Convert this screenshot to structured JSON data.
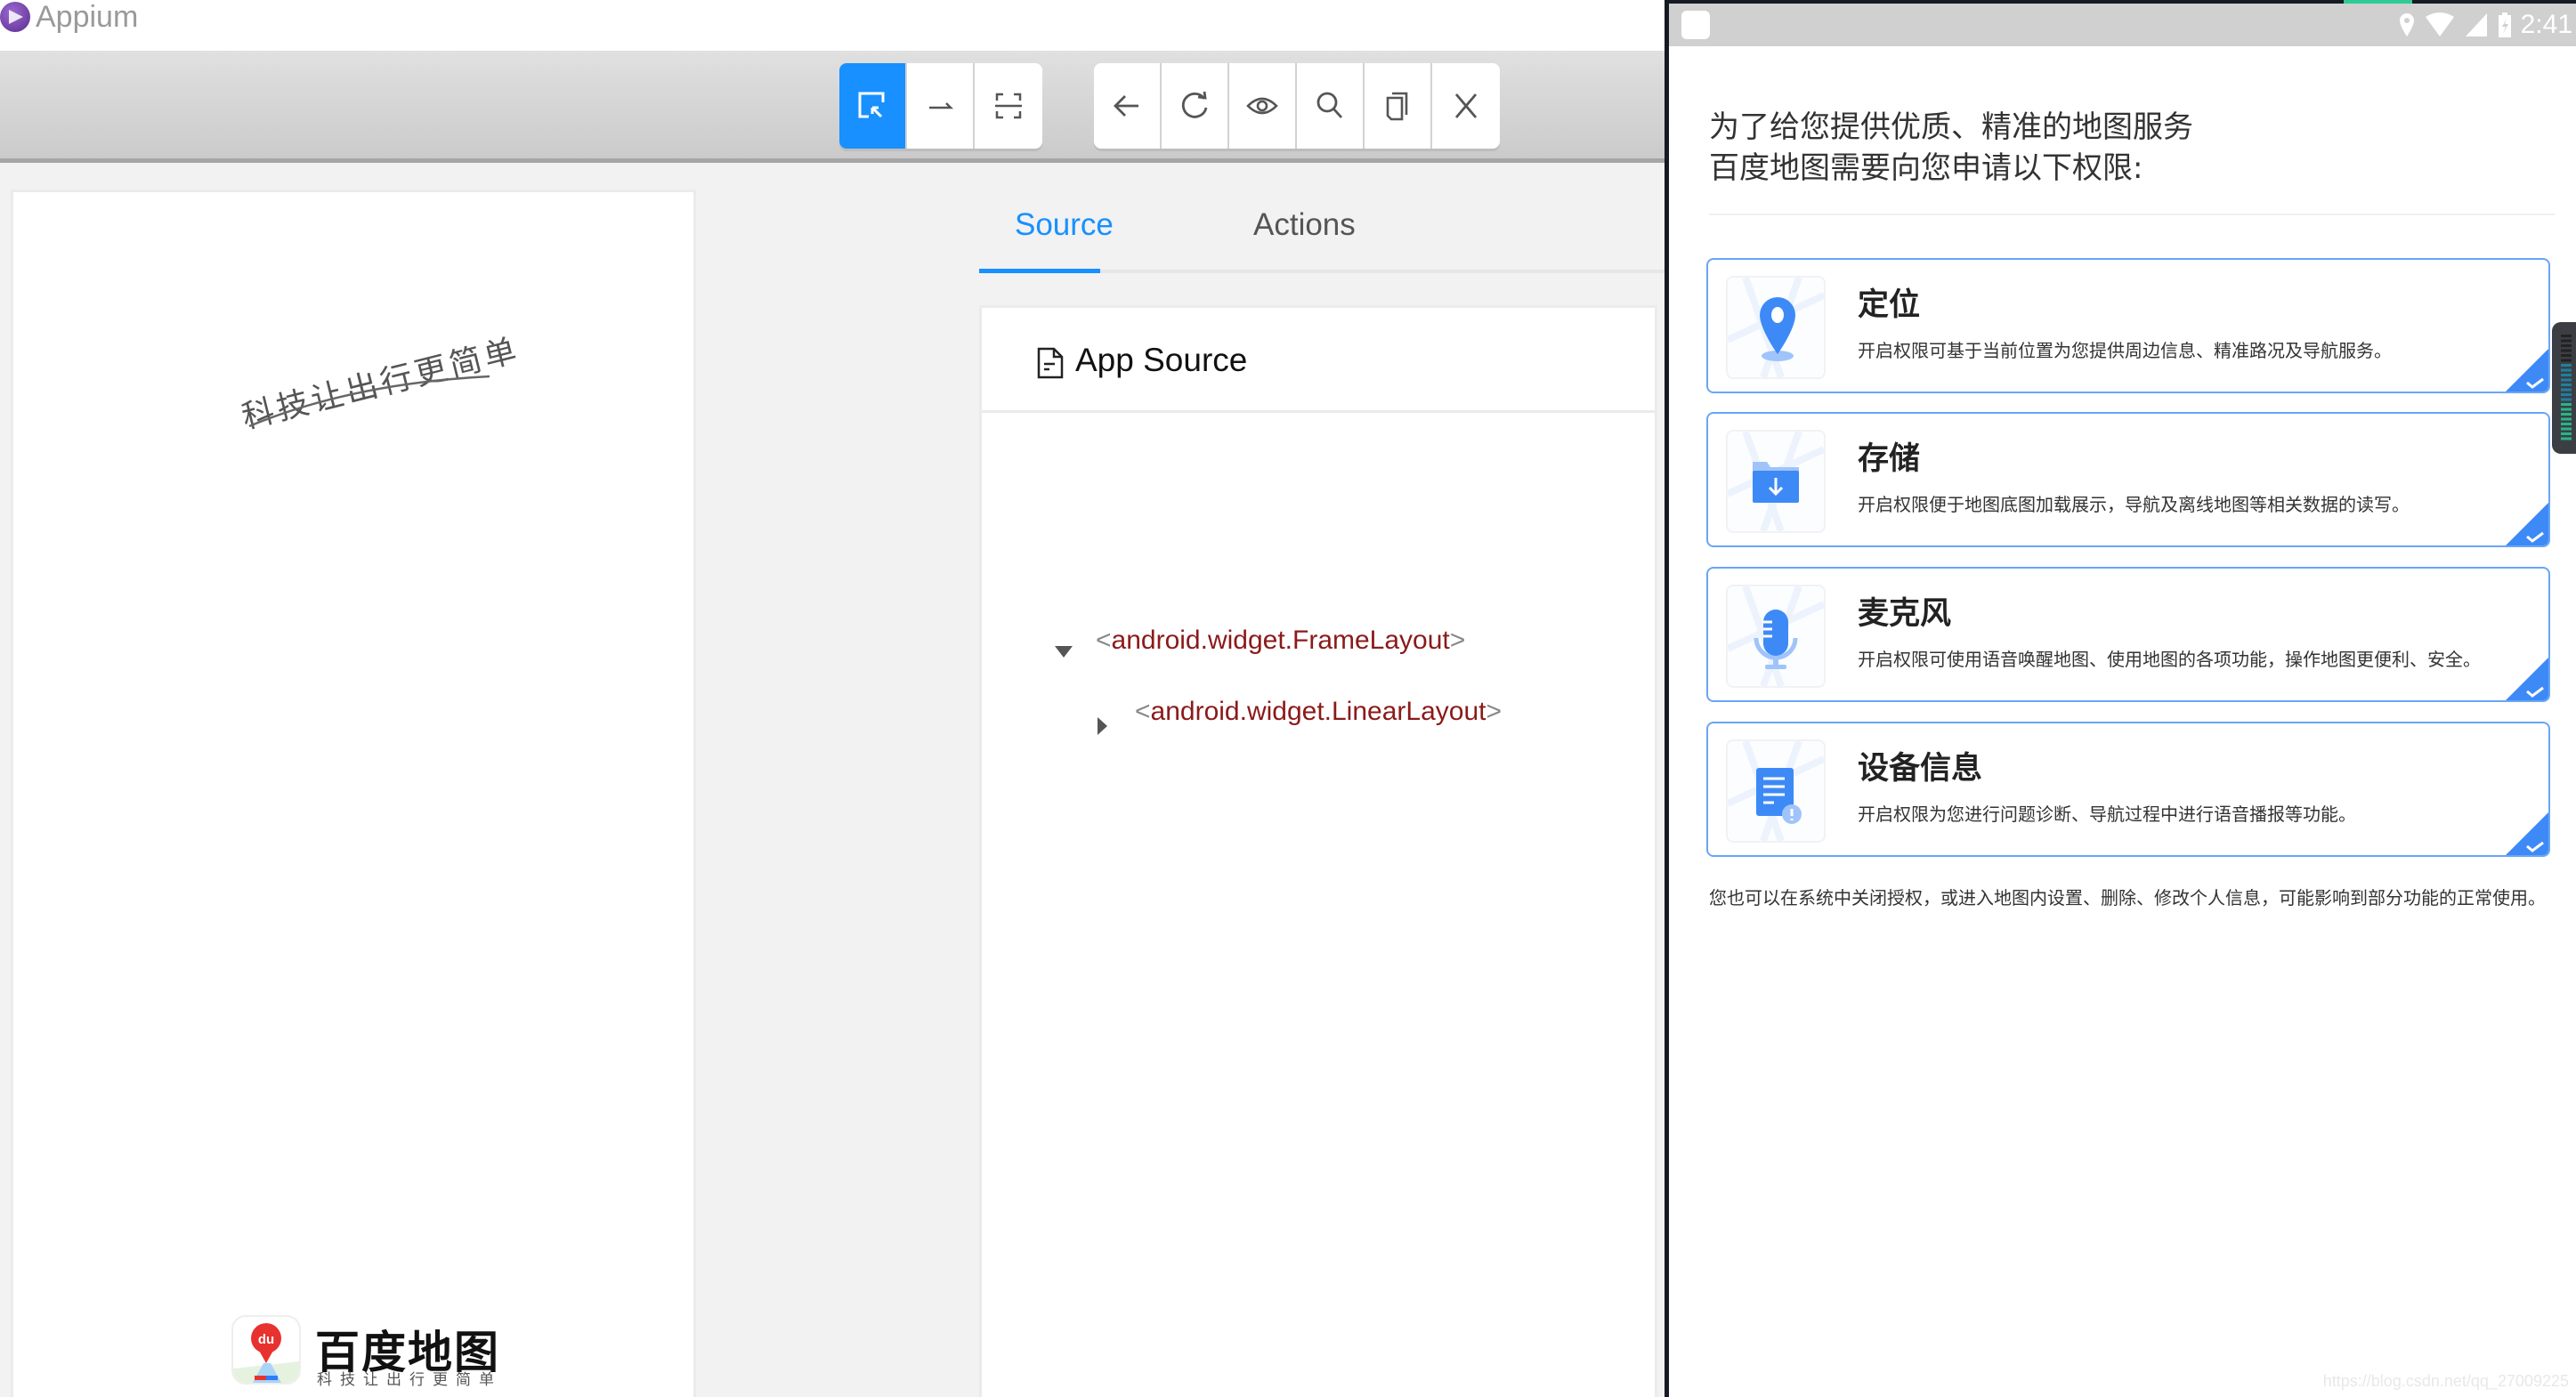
{
  "app": {
    "title": "Appium"
  },
  "toolbar": {
    "group1": [
      {
        "name": "select-elements",
        "icon": "select-element-icon",
        "active": true
      },
      {
        "name": "swipe-by-coordinates",
        "icon": "swipe-icon",
        "active": false
      },
      {
        "name": "tap-by-coordinates",
        "icon": "scan-frame-icon",
        "active": false
      }
    ],
    "group2": [
      {
        "name": "back",
        "icon": "arrow-left-icon"
      },
      {
        "name": "refresh",
        "icon": "refresh-icon"
      },
      {
        "name": "start-recording",
        "icon": "eye-icon"
      },
      {
        "name": "search-elements",
        "icon": "search-icon"
      },
      {
        "name": "copy-xml-source",
        "icon": "copy-icon"
      },
      {
        "name": "quit-session",
        "icon": "close-icon"
      }
    ]
  },
  "screenshot": {
    "slogan": "科技让出行更简单",
    "logo_name": "百度地图",
    "logo_tagline": "科技让出行更简单",
    "logo_badge": "du"
  },
  "tabs": [
    {
      "label": "Source",
      "active": true
    },
    {
      "label": "Actions",
      "active": false
    }
  ],
  "source": {
    "title": "App Source",
    "tree": [
      {
        "tag": "android.widget.FrameLayout",
        "expanded": true,
        "depth": 0
      },
      {
        "tag": "android.widget.LinearLayout",
        "expanded": false,
        "depth": 1
      }
    ]
  },
  "device": {
    "status_bar": {
      "time": "2:41",
      "icons": [
        "location-icon",
        "wifi-icon",
        "signal-icon",
        "battery-charging-icon"
      ]
    },
    "intro_line1": "为了给您提供优质、精准的地图服务",
    "intro_line2": "百度地图需要向您申请以下权限:",
    "permissions": [
      {
        "title": "定位",
        "desc": "开启权限可基于当前位置为您提供周边信息、精准路况及导航服务。",
        "icon": "location-pin-icon",
        "checked": true
      },
      {
        "title": "存储",
        "desc": "开启权限便于地图底图加载展示，导航及离线地图等相关数据的读写。",
        "icon": "folder-download-icon",
        "checked": true
      },
      {
        "title": "麦克风",
        "desc": "开启权限可使用语音唤醒地图、使用地图的各项功能，操作地图更便利、安全。",
        "icon": "microphone-icon",
        "checked": true
      },
      {
        "title": "设备信息",
        "desc": "开启权限为您进行问题诊断、导航过程中进行语音播报等功能。",
        "icon": "device-info-icon",
        "checked": true
      }
    ],
    "footer_note": "您也可以在系统中关闭授权，或进入地图内设置、删除、修改个人信息，可能影响到部分功能的正常使用。",
    "watermark": "https://blog.csdn.net/qq_27009225"
  },
  "colors": {
    "accent": "#1890ff",
    "tag_text": "#8b1a1a",
    "perm_border": "#6aa5f5",
    "perm_icon_blue": "#3d8af7"
  }
}
